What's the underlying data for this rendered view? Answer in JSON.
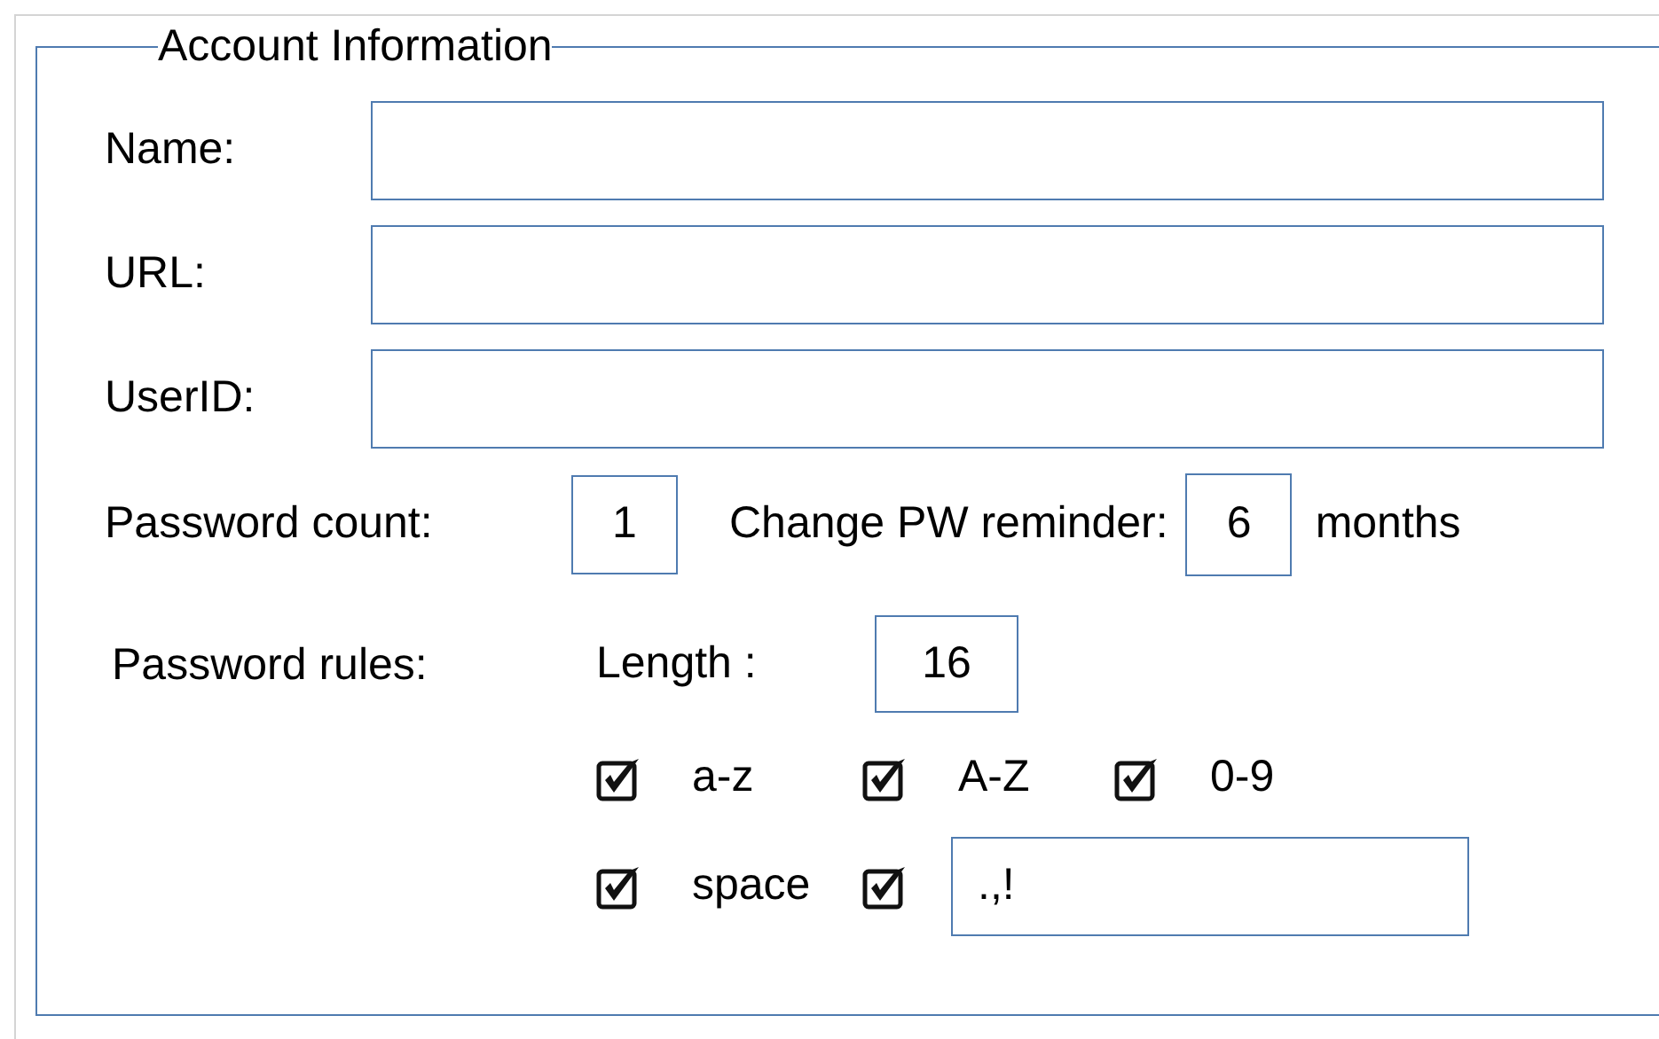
{
  "group": {
    "title": "Account Information"
  },
  "fields": [
    {
      "label": "Name:"
    },
    {
      "label": "URL:"
    },
    {
      "label": "UserID:"
    }
  ],
  "password_count": {
    "label": "Password count:",
    "value": "1"
  },
  "reminder": {
    "label": "Change PW reminder:",
    "value": "6",
    "unit": "months"
  },
  "rules": {
    "label": "Password rules:",
    "length_label": "Length :",
    "length_value": "16",
    "options": [
      {
        "kind": "checkbox",
        "label": "a-z",
        "checked": true
      },
      {
        "kind": "checkbox",
        "label": "A-Z",
        "checked": true
      },
      {
        "kind": "checkbox",
        "label": "0-9",
        "checked": true
      },
      {
        "kind": "checkbox",
        "label": "space",
        "checked": true
      },
      {
        "kind": "checkbox_field",
        "value": ".,!",
        "checked": true
      }
    ]
  }
}
